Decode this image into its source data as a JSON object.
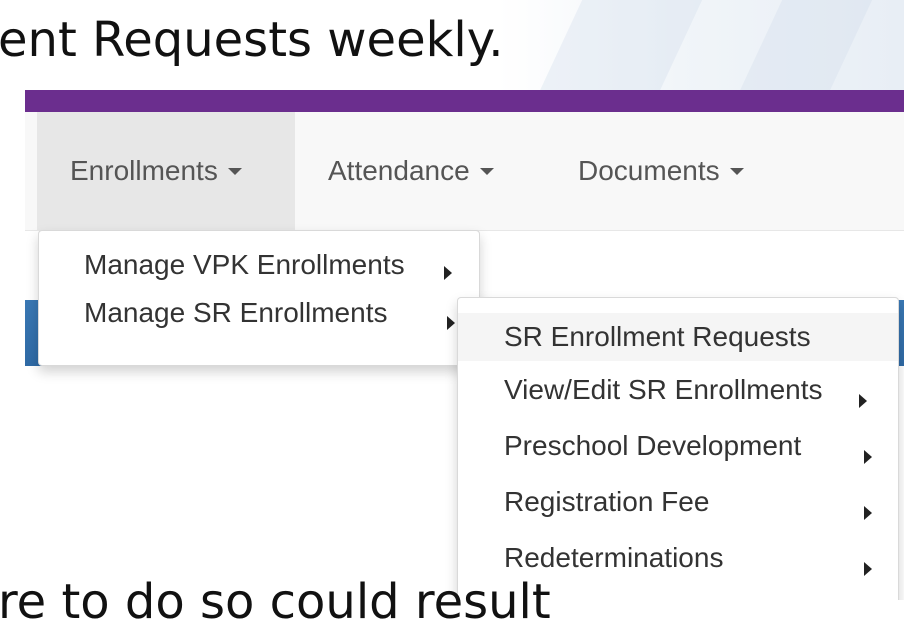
{
  "slide": {
    "title_fragment": "ent Requests weekly.",
    "bottom_fragment": "re to do so could result"
  },
  "nav": {
    "items": [
      {
        "label": "Enrollments"
      },
      {
        "label": "Attendance"
      },
      {
        "label": "Documents"
      }
    ]
  },
  "enrollments_menu": {
    "items": [
      {
        "label": "Manage VPK Enrollments"
      },
      {
        "label": "Manage SR Enrollments"
      }
    ]
  },
  "sr_submenu": {
    "items": [
      {
        "label": "SR Enrollment Requests"
      },
      {
        "label": "View/Edit SR Enrollments"
      },
      {
        "label": "Preschool Development"
      },
      {
        "label": "Registration Fee"
      },
      {
        "label": "Redeterminations"
      }
    ]
  },
  "colors": {
    "purple_bar": "#6b2e8e",
    "blue_band": "#3a78b4",
    "navbar_bg": "#f8f8f8",
    "active_tab_bg": "#e7e7e7"
  }
}
